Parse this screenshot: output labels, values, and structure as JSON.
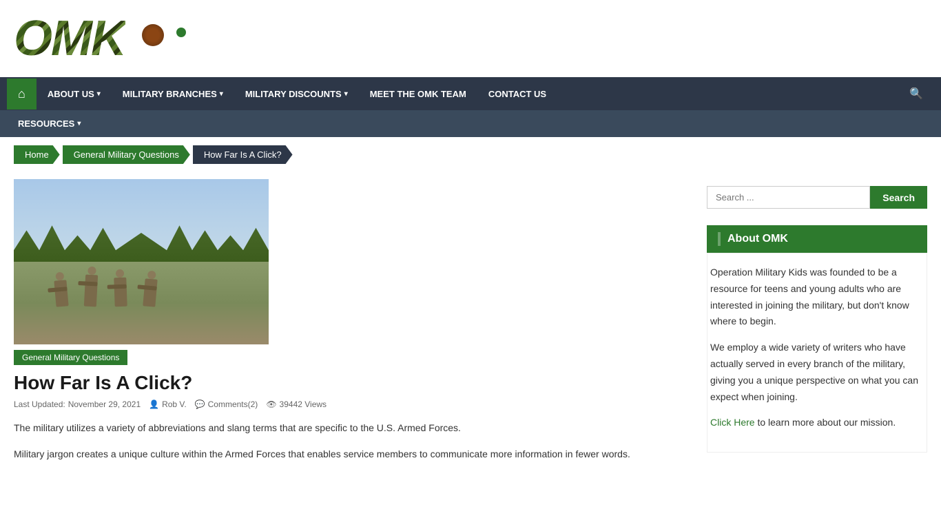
{
  "logo": {
    "text": "OMK",
    "alt": "Operation Military Kids Logo"
  },
  "nav": {
    "primary": [
      {
        "label": "ABOUT US",
        "hasDropdown": true
      },
      {
        "label": "MILITARY BRANCHES",
        "hasDropdown": true
      },
      {
        "label": "MILITARY DISCOUNTS",
        "hasDropdown": true
      },
      {
        "label": "MEET THE OMK TEAM",
        "hasDropdown": false
      },
      {
        "label": "CONTACT US",
        "hasDropdown": false
      }
    ],
    "secondary": [
      {
        "label": "RESOURCES",
        "hasDropdown": true
      }
    ]
  },
  "breadcrumb": [
    {
      "label": "Home",
      "active": false
    },
    {
      "label": "General Military Questions",
      "active": false
    },
    {
      "label": "How Far Is A Click?",
      "active": true
    }
  ],
  "article": {
    "category": "General Military Questions",
    "title": "How Far Is A Click?",
    "meta": {
      "updated_label": "Last Updated:",
      "updated_date": "November 29, 2021",
      "author": "Rob V.",
      "comments": "Comments(2)",
      "views": "39442 Views"
    },
    "body": [
      "The military utilizes a variety of abbreviations and slang terms that are specific to the U.S. Armed Forces.",
      "Military jargon creates a unique culture within the Armed Forces that enables service members to communicate more information in fewer words."
    ]
  },
  "sidebar": {
    "search": {
      "placeholder": "Search ...",
      "button_label": "Search"
    },
    "about_widget": {
      "title": "About OMK",
      "paragraphs": [
        "Operation Military Kids was founded to be a resource for teens and young adults who are interested in joining the military, but don't know where to begin.",
        "We employ a wide variety of writers who have actually served in every branch of the military, giving you a unique perspective on what you can expect when joining.",
        "Click Here to learn more about our mission."
      ],
      "link_text": "Click Here",
      "link_suffix": " to learn more about our mission."
    }
  }
}
